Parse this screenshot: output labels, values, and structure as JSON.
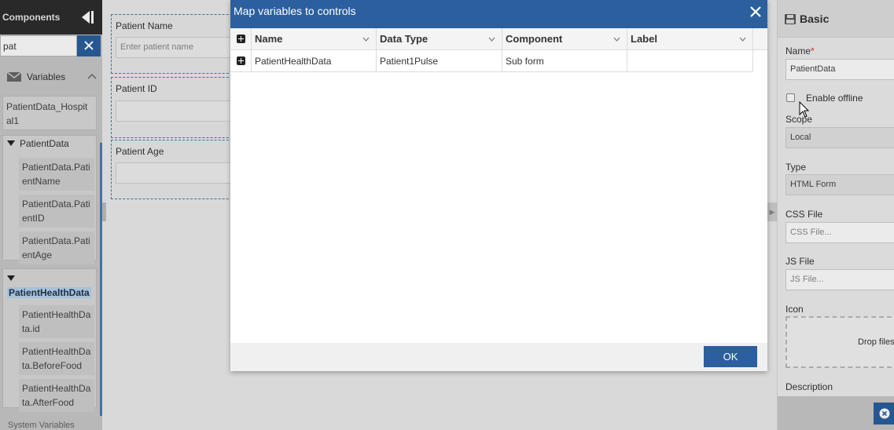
{
  "left_panel": {
    "title": "Components",
    "search_value": "pat",
    "variables_header": "Variables",
    "hospital_var": "PatientData_Hospital1",
    "patient_group": {
      "label": "PatientData",
      "children": [
        "PatientData.PatientName",
        "PatientData.PatientID",
        "PatientData.PatientAge"
      ]
    },
    "health_group": {
      "label": "PatientHealthData",
      "children": [
        "PatientHealthData.id",
        "PatientHealthData.BeforeFood",
        "PatientHealthData.AfterFood"
      ]
    },
    "bottom_item": "System Variables"
  },
  "canvas": {
    "fields": [
      {
        "label": "Patient Name",
        "placeholder": "Enter patient name"
      },
      {
        "label": "Patient ID",
        "placeholder": ""
      },
      {
        "label": "Patient Age",
        "placeholder": ""
      }
    ]
  },
  "right_panel": {
    "section_title": "Basic",
    "name_label": "Name",
    "required_mark": "*",
    "name_value": "PatientData",
    "enable_offline_label": "Enable offline",
    "enable_offline_checked": false,
    "scope_label": "Scope",
    "scope_value": "Local",
    "type_label": "Type",
    "type_value": "HTML Form",
    "css_label": "CSS File",
    "css_placeholder": "CSS File...",
    "js_label": "JS File",
    "js_placeholder": "JS File...",
    "icon_label": "Icon",
    "drop_text": "Drop files",
    "description_label": "Description"
  },
  "modal": {
    "title": "Map variables to controls",
    "columns": [
      "Name",
      "Data Type",
      "Component",
      "Label"
    ],
    "rows": [
      {
        "name": "PatientHealthData",
        "data_type": "Patient1Pulse",
        "component": "Sub form",
        "label": ""
      }
    ],
    "ok_label": "OK"
  },
  "colors": {
    "accent": "#2b5f9e",
    "dark_header": "#2d2d2d",
    "highlight": "#b5d3ee"
  }
}
